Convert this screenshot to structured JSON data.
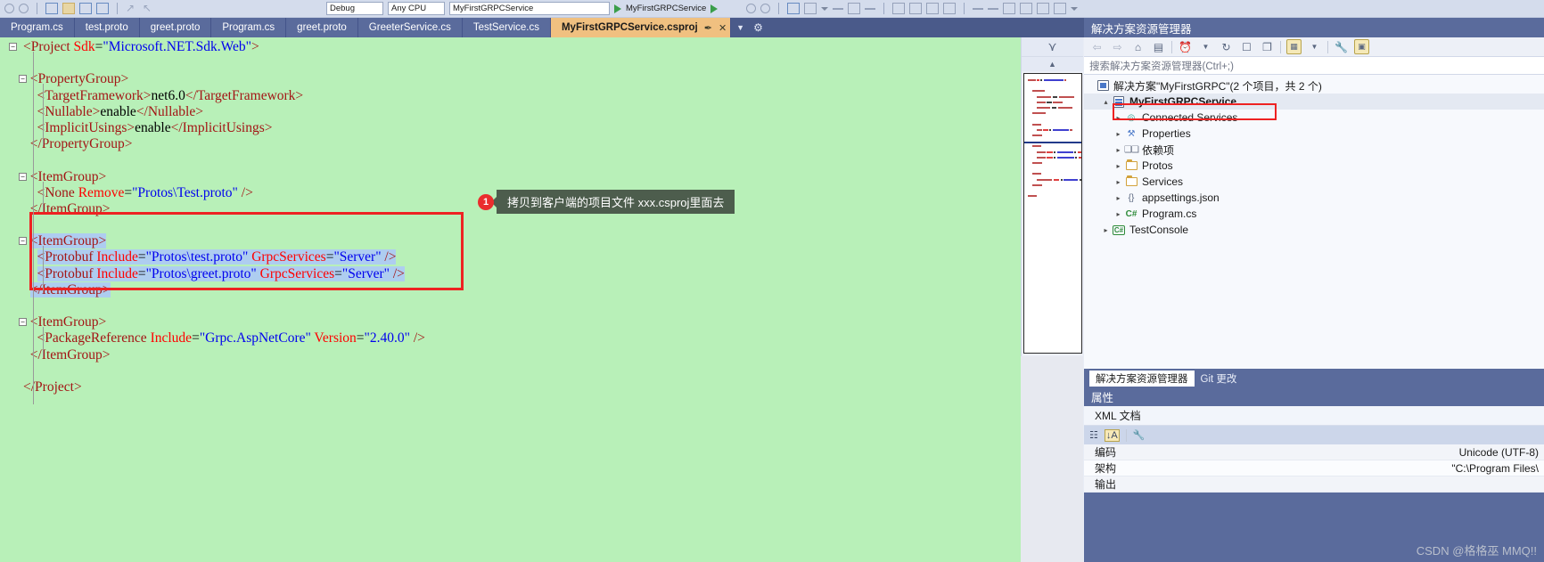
{
  "toolbar": {
    "debug_config": "Debug",
    "platform": "Any CPU",
    "startup_project": "MyFirstGRPCService",
    "run_label": "MyFirstGRPCService",
    "icons": [
      "undo-icon",
      "redo-icon",
      "new-item-icon",
      "open-folder-icon",
      "save-icon",
      "save-all-icon",
      "nav-back-icon",
      "nav-forward-icon",
      "start-debug-icon",
      "comment-icon",
      "uncomment-icon",
      "indent-icon",
      "outdent-icon",
      "bookmark-icon",
      "find-icon"
    ]
  },
  "tabs": [
    {
      "label": "Program.cs",
      "active": false
    },
    {
      "label": "test.proto",
      "active": false
    },
    {
      "label": "greet.proto",
      "active": false
    },
    {
      "label": "Program.cs",
      "active": false
    },
    {
      "label": "greet.proto",
      "active": false
    },
    {
      "label": "GreeterService.cs",
      "active": false
    },
    {
      "label": "TestService.cs",
      "active": false
    },
    {
      "label": "MyFirstGRPCService.csproj",
      "active": true,
      "pin": "✒",
      "close": "✕"
    }
  ],
  "editor": {
    "background": "#b8f0b8",
    "selection_color": "#aecdf0",
    "lines": [
      {
        "indent": 0,
        "fold": "minus",
        "segs": [
          {
            "t": "<Project ",
            "c": "tag"
          },
          {
            "t": "Sdk",
            "c": "attr"
          },
          {
            "t": "=",
            "c": "txt"
          },
          {
            "t": "\"Microsoft.NET.Sdk.Web\"",
            "c": "val"
          },
          {
            "t": ">",
            "c": "tag"
          }
        ]
      },
      {
        "indent": 0,
        "segs": []
      },
      {
        "indent": 1,
        "fold": "minus",
        "segs": [
          {
            "t": "<PropertyGroup>",
            "c": "tag"
          }
        ]
      },
      {
        "indent": 2,
        "segs": [
          {
            "t": "<TargetFramework>",
            "c": "tag"
          },
          {
            "t": "net6.0",
            "c": "txt"
          },
          {
            "t": "</TargetFramework>",
            "c": "tag"
          }
        ]
      },
      {
        "indent": 2,
        "segs": [
          {
            "t": "<Nullable>",
            "c": "tag"
          },
          {
            "t": "enable",
            "c": "txt"
          },
          {
            "t": "</Nullable>",
            "c": "tag"
          }
        ]
      },
      {
        "indent": 2,
        "segs": [
          {
            "t": "<ImplicitUsings>",
            "c": "tag"
          },
          {
            "t": "enable",
            "c": "txt"
          },
          {
            "t": "</ImplicitUsings>",
            "c": "tag"
          }
        ]
      },
      {
        "indent": 1,
        "segs": [
          {
            "t": "</PropertyGroup>",
            "c": "tag"
          }
        ]
      },
      {
        "indent": 0,
        "segs": []
      },
      {
        "indent": 1,
        "fold": "minus",
        "segs": [
          {
            "t": "<ItemGroup>",
            "c": "tag"
          }
        ]
      },
      {
        "indent": 2,
        "segs": [
          {
            "t": "<None ",
            "c": "tag"
          },
          {
            "t": "Remove",
            "c": "attr"
          },
          {
            "t": "=",
            "c": "txt"
          },
          {
            "t": "\"Protos\\Test.proto\"",
            "c": "val"
          },
          {
            "t": " />",
            "c": "tag"
          }
        ]
      },
      {
        "indent": 1,
        "segs": [
          {
            "t": "</ItemGroup>",
            "c": "tag"
          }
        ]
      },
      {
        "indent": 0,
        "segs": []
      },
      {
        "indent": 1,
        "fold": "minus",
        "selected": true,
        "segs": [
          {
            "t": "<ItemGroup>",
            "c": "tag"
          }
        ]
      },
      {
        "indent": 2,
        "selected": true,
        "segs": [
          {
            "t": "<Protobuf ",
            "c": "tag"
          },
          {
            "t": "Include",
            "c": "attr"
          },
          {
            "t": "=",
            "c": "txt"
          },
          {
            "t": "\"Protos\\test.proto\"",
            "c": "val"
          },
          {
            "t": " ",
            "c": "txt"
          },
          {
            "t": "GrpcServices",
            "c": "attr"
          },
          {
            "t": "=",
            "c": "txt"
          },
          {
            "t": "\"Server\"",
            "c": "val"
          },
          {
            "t": " />",
            "c": "tag"
          }
        ]
      },
      {
        "indent": 2,
        "selected": true,
        "segs": [
          {
            "t": "<Protobuf ",
            "c": "tag"
          },
          {
            "t": "Include",
            "c": "attr"
          },
          {
            "t": "=",
            "c": "txt"
          },
          {
            "t": "\"Protos\\greet.proto\"",
            "c": "val"
          },
          {
            "t": " ",
            "c": "txt"
          },
          {
            "t": "GrpcServices",
            "c": "attr"
          },
          {
            "t": "=",
            "c": "txt"
          },
          {
            "t": "\"Server\"",
            "c": "val"
          },
          {
            "t": " />",
            "c": "tag"
          }
        ]
      },
      {
        "indent": 1,
        "selected": true,
        "segs": [
          {
            "t": "</ItemGroup>",
            "c": "tag"
          }
        ]
      },
      {
        "indent": 0,
        "segs": []
      },
      {
        "indent": 1,
        "fold": "minus",
        "segs": [
          {
            "t": "<ItemGroup>",
            "c": "tag"
          }
        ]
      },
      {
        "indent": 2,
        "segs": [
          {
            "t": "<PackageReference ",
            "c": "tag"
          },
          {
            "t": "Include",
            "c": "attr"
          },
          {
            "t": "=",
            "c": "txt"
          },
          {
            "t": "\"Grpc.AspNetCore\"",
            "c": "val"
          },
          {
            "t": " ",
            "c": "txt"
          },
          {
            "t": "Version",
            "c": "attr"
          },
          {
            "t": "=",
            "c": "txt"
          },
          {
            "t": "\"2.40.0\"",
            "c": "val"
          },
          {
            "t": " />",
            "c": "tag"
          }
        ]
      },
      {
        "indent": 1,
        "segs": [
          {
            "t": "</ItemGroup>",
            "c": "tag"
          }
        ]
      },
      {
        "indent": 0,
        "segs": []
      },
      {
        "indent": 0,
        "segs": [
          {
            "t": "</Project>",
            "c": "tag"
          }
        ]
      }
    ]
  },
  "callout": {
    "number": "1",
    "text": "拷贝到客户端的项目文件 xxx.csproj里面去",
    "bubble_color": "#4d5d4d",
    "badge_color": "#ea2d2d"
  },
  "annotation": {
    "highlight_color": "#ee2222"
  },
  "solution_explorer": {
    "title": "解决方案资源管理器",
    "toolbar_icons": [
      "back-icon",
      "forward-icon",
      "home-icon",
      "sync-with-active-document-icon",
      "pending-changes-icon",
      "refresh-icon",
      "collapse-all-icon",
      "show-all-files-icon",
      "properties-window-icon",
      "wrench-icon",
      "preview-selected-items-icon"
    ],
    "search_placeholder": "搜索解决方案资源管理器(Ctrl+;)",
    "solution_label": "解决方案\"MyFirstGRPC\"(2 个项目，共 2 个)",
    "tree": [
      {
        "label": "MyFirstGRPCService",
        "depth": 1,
        "expander": "▴",
        "icon": "project-icon",
        "bold": true,
        "highlighted": true
      },
      {
        "label": "Connected Services",
        "depth": 2,
        "expander": "▸",
        "icon": "connected-services-icon"
      },
      {
        "label": "Properties",
        "depth": 2,
        "expander": "▸",
        "icon": "properties-icon"
      },
      {
        "label": "依赖项",
        "depth": 2,
        "expander": "▸",
        "icon": "dependencies-icon"
      },
      {
        "label": "Protos",
        "depth": 2,
        "expander": "▸",
        "icon": "folder-icon"
      },
      {
        "label": "Services",
        "depth": 2,
        "expander": "▸",
        "icon": "folder-icon"
      },
      {
        "label": "appsettings.json",
        "depth": 2,
        "expander": "▸",
        "icon": "json-file-icon"
      },
      {
        "label": "Program.cs",
        "depth": 2,
        "expander": "▸",
        "icon": "csharp-file-icon"
      },
      {
        "label": "TestConsole",
        "depth": 1,
        "expander": "▸",
        "icon": "csharp-project-icon"
      }
    ],
    "dock_tabs": [
      {
        "label": "解决方案资源管理器",
        "active": true
      },
      {
        "label": "Git 更改",
        "active": false
      }
    ]
  },
  "properties_panel": {
    "title": "属性",
    "object_name": "XML 文档",
    "toolbar_icons": [
      "categorized-icon",
      "alphabetical-icon",
      "property-pages-icon"
    ],
    "rows": [
      {
        "key": "编码",
        "value": "Unicode (UTF-8)"
      },
      {
        "key": "架构",
        "value": "\"C:\\Program Files\\"
      },
      {
        "key": "输出",
        "value": ""
      }
    ]
  },
  "watermark": "CSDN @格格巫  MMQ!!"
}
